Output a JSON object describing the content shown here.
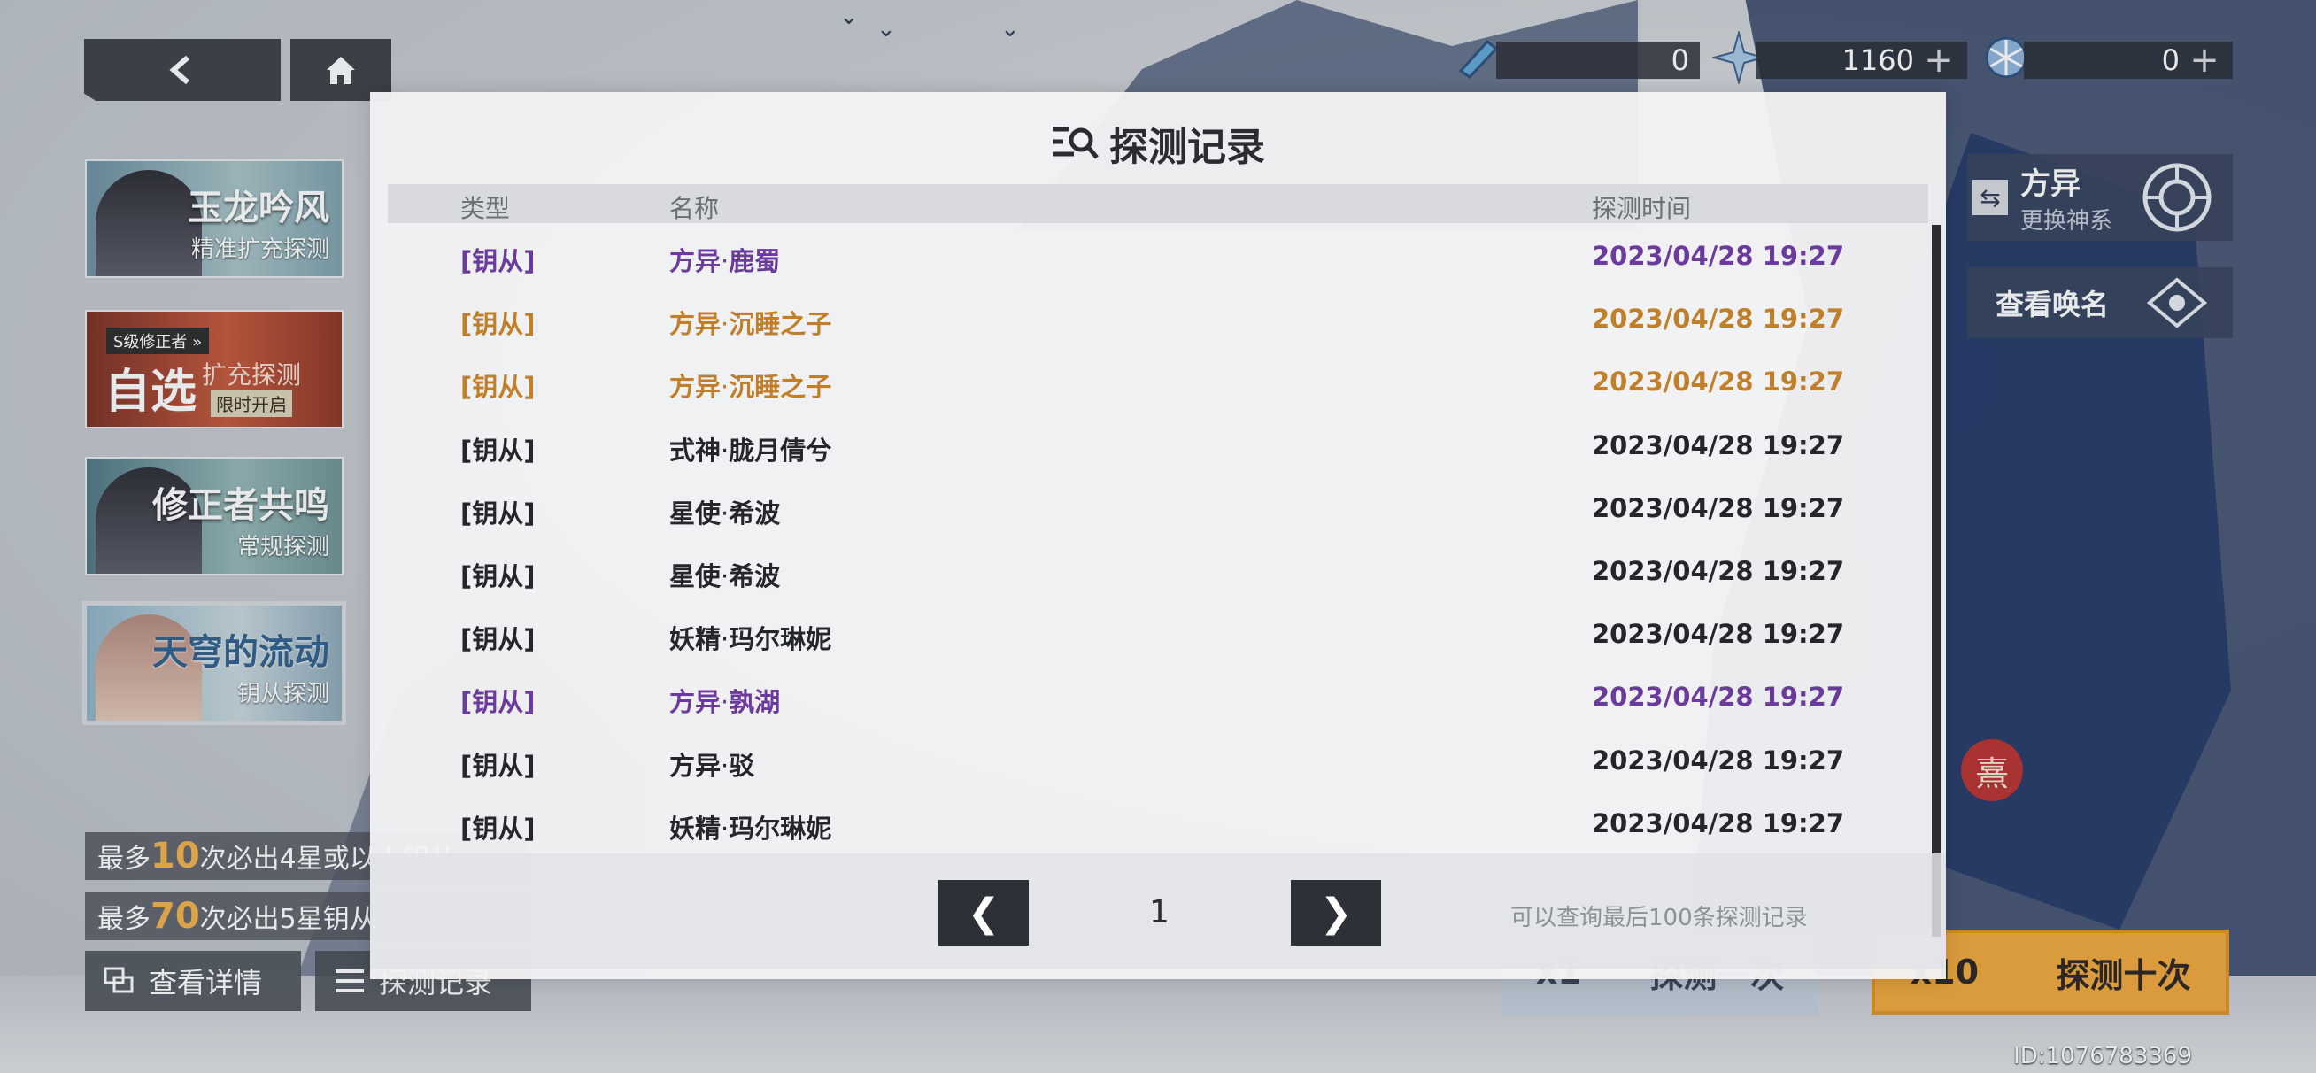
{
  "currency": [
    {
      "icon": "rocket-ticket-icon",
      "value": "0",
      "has_plus": false
    },
    {
      "icon": "crystal-star-icon",
      "value": "1160",
      "has_plus": true
    },
    {
      "icon": "snowflake-gem-icon",
      "value": "0",
      "has_plus": true
    }
  ],
  "banners": [
    {
      "title": "玉龙吟风",
      "subtitle": "精准扩充探测"
    },
    {
      "tag": "S级修正者 »",
      "big": "自选",
      "title": "扩充探测",
      "subtitle": "限时开启"
    },
    {
      "title": "修正者共鸣",
      "subtitle": "常规探测"
    },
    {
      "title": "天穹的流动",
      "subtitle": "钥从探测"
    }
  ],
  "pity": [
    {
      "prefix": "最多",
      "num": "10",
      "suffix": "次必出4星或以上钥从"
    },
    {
      "prefix": "最多",
      "num": "70",
      "suffix": "次必出5星钥从"
    }
  ],
  "bottom_buttons": {
    "details": "查看详情",
    "records": "探测记录"
  },
  "right": {
    "faction_name": "方异",
    "faction_sub": "更换神系",
    "view_name": "查看唤名",
    "pull_once_count": "x1",
    "pull_once_label": "探测一次",
    "pull_ten_count": "x10",
    "pull_ten_label": "探测十次",
    "seal_char": "熹",
    "uid": "ID:1076783369"
  },
  "modal": {
    "title": "探测记录",
    "columns": {
      "type": "类型",
      "name": "名称",
      "time": "探测时间"
    },
    "rows": [
      {
        "type": "[钥从]",
        "faction": "方异",
        "name": "鹿蜀",
        "time": "2023/04/28 19:27",
        "rarity": "purple"
      },
      {
        "type": "[钥从]",
        "faction": "方异",
        "name": "沉睡之子",
        "time": "2023/04/28 19:27",
        "rarity": "gold"
      },
      {
        "type": "[钥从]",
        "faction": "方异",
        "name": "沉睡之子",
        "time": "2023/04/28 19:27",
        "rarity": "gold"
      },
      {
        "type": "[钥从]",
        "faction": "式神",
        "name": "胧月倩兮",
        "time": "2023/04/28 19:27",
        "rarity": "normal"
      },
      {
        "type": "[钥从]",
        "faction": "星使",
        "name": "希波",
        "time": "2023/04/28 19:27",
        "rarity": "normal"
      },
      {
        "type": "[钥从]",
        "faction": "星使",
        "name": "希波",
        "time": "2023/04/28 19:27",
        "rarity": "normal"
      },
      {
        "type": "[钥从]",
        "faction": "妖精",
        "name": "玛尔琳妮",
        "time": "2023/04/28 19:27",
        "rarity": "normal"
      },
      {
        "type": "[钥从]",
        "faction": "方异",
        "name": "孰湖",
        "time": "2023/04/28 19:27",
        "rarity": "purple"
      },
      {
        "type": "[钥从]",
        "faction": "方异",
        "name": "驳",
        "time": "2023/04/28 19:27",
        "rarity": "normal"
      },
      {
        "type": "[钥从]",
        "faction": "妖精",
        "name": "玛尔琳妮",
        "time": "2023/04/28 19:27",
        "rarity": "normal"
      }
    ],
    "rarity_colors": {
      "purple": "#6a3a9c",
      "gold": "#c17f2a",
      "normal": "#24262b"
    },
    "name_separator": "·",
    "page": "1",
    "prev_label": "❮",
    "next_label": "❯",
    "note": "可以查询最后100条探测记录"
  }
}
